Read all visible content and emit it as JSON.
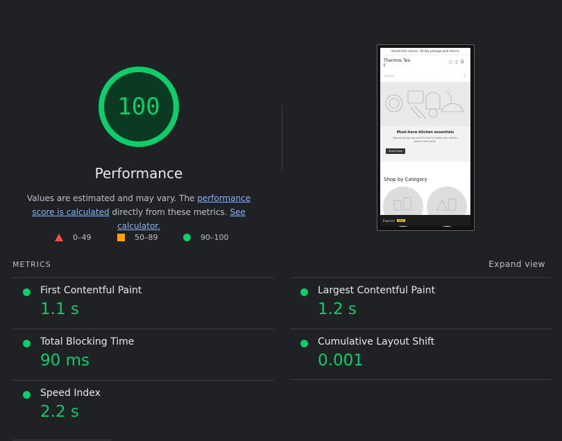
{
  "performance": {
    "score": "100",
    "title": "Performance",
    "desc_prefix": "Values are estimated and may vary. The ",
    "link1": "performance score is calculated",
    "desc_mid": " directly from these metrics. ",
    "link2": "See calculator.",
    "score_fraction": 1.0
  },
  "legend": {
    "fail": "0–49",
    "average": "50–89",
    "pass": "90–100"
  },
  "colors": {
    "pass": "#0cce6b",
    "average": "#ffa400",
    "fail": "#ff4e42"
  },
  "screenshot": {
    "announcement": "Hassle-free returns. 30-day postage paid returns",
    "store_name": "Thermos Tea t",
    "search_placeholder": "Search",
    "hero_heading": "Must-have kitchen essentials",
    "hero_sub": "Spring has sprung and it's time to make your kitchen space more joyful.",
    "hero_button": "Shop Home",
    "category_title": "Shop by Category",
    "footer_text": "Expense",
    "footer_badge": "New"
  },
  "metrics": {
    "section_title": "METRICS",
    "expand_label": "Expand view",
    "items": [
      {
        "label": "First Contentful Paint",
        "value": "1.1 s"
      },
      {
        "label": "Largest Contentful Paint",
        "value": "1.2 s"
      },
      {
        "label": "Total Blocking Time",
        "value": "90 ms"
      },
      {
        "label": "Cumulative Layout Shift",
        "value": "0.001"
      },
      {
        "label": "Speed Index",
        "value": "2.2 s"
      }
    ]
  }
}
